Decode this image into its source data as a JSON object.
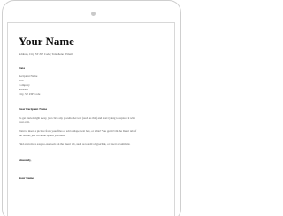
{
  "letter": {
    "name": "Your Name",
    "contact": "Address, City, ST ZIP Code | Telephone | Email",
    "date": "Date",
    "recipient": [
      "Recipient Name",
      "Title",
      "Company",
      "Address",
      "City, ST ZIP Code"
    ],
    "salutation": "Dear Recipient Name",
    "paragraphs": [
      "To get started right away, just click any placeholder text (such as this) and start typing to replace it with your own.",
      "Want to insert a picture from your files or add a shape, text box, or table? You got it! On the Insert tab of the ribbon, just click the option you need.",
      "Find even more easy-to-use tools on the Insert tab, such as to add a hyperlink, or insert a comment."
    ],
    "closing": "Sincerely,",
    "signature": "Your Name"
  },
  "colors": {
    "text": "#222222",
    "muted": "#555555",
    "rule": "#333333",
    "frame": "#cfcfcf"
  }
}
